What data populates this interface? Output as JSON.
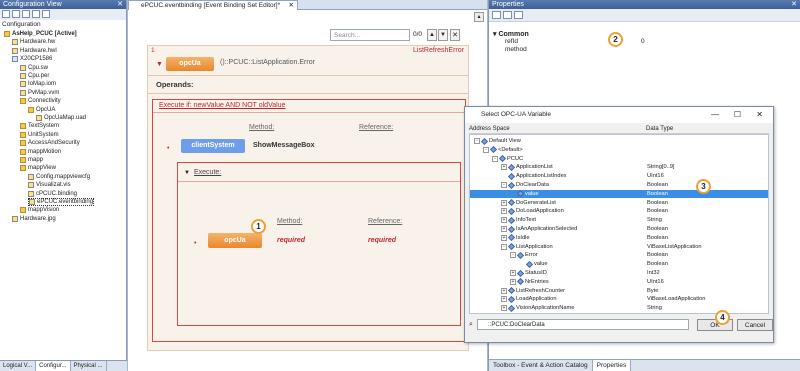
{
  "left_panel": {
    "title": "Configuration View",
    "config_label": "Configuration",
    "tree": [
      {
        "label": "AsHelp_PCUC [Active]",
        "indent": 0,
        "bold": true,
        "icon": "folder"
      },
      {
        "label": "Hardware.hw",
        "indent": 1,
        "icon": "file"
      },
      {
        "label": "Hardware.hwl",
        "indent": 1,
        "icon": "file"
      },
      {
        "label": "X20CP1586",
        "indent": 1,
        "icon": "cpu"
      },
      {
        "label": "Cpu.sw",
        "indent": 2,
        "icon": "file"
      },
      {
        "label": "Cpu.per",
        "indent": 2,
        "icon": "file"
      },
      {
        "label": "IoMap.iom",
        "indent": 2,
        "icon": "file"
      },
      {
        "label": "PvMap.vvm",
        "indent": 2,
        "icon": "file"
      },
      {
        "label": "Connectivity",
        "indent": 2,
        "icon": "folder"
      },
      {
        "label": "OpcUA",
        "indent": 3,
        "icon": "folder"
      },
      {
        "label": "OpcUaMap.uad",
        "indent": 4,
        "icon": "file"
      },
      {
        "label": "TextSystem",
        "indent": 2,
        "icon": "folder"
      },
      {
        "label": "UnitSystem",
        "indent": 2,
        "icon": "folder"
      },
      {
        "label": "AccessAndSecurity",
        "indent": 2,
        "icon": "folder"
      },
      {
        "label": "mappMotion",
        "indent": 2,
        "icon": "folder"
      },
      {
        "label": "mapp",
        "indent": 2,
        "icon": "folder"
      },
      {
        "label": "mappView",
        "indent": 2,
        "icon": "folder"
      },
      {
        "label": "Config.mappviewcfg",
        "indent": 3,
        "icon": "file"
      },
      {
        "label": "Visualizat.vis",
        "indent": 3,
        "icon": "file"
      },
      {
        "label": "cPCUC.binding",
        "indent": 3,
        "icon": "file"
      },
      {
        "label": "ePCUC.eventbinding",
        "indent": 3,
        "icon": "file",
        "selected": true
      },
      {
        "label": "mappVision",
        "indent": 2,
        "icon": "folder"
      },
      {
        "label": "Hardware.jpg",
        "indent": 1,
        "icon": "file"
      }
    ],
    "tabs": [
      "Logical V...",
      "Configur...",
      "Physical ..."
    ]
  },
  "editor": {
    "tab_title": "ePCUC.eventbinding [Event Binding Set Editor]*",
    "search_placeholder": "Search...",
    "search_counter": "0/0",
    "event_index": "1",
    "event_name": "ListRefreshError",
    "source_badge": "opcUa",
    "source_path": "()::PCUC::ListApplication.Error",
    "operands_label": "Operands:",
    "condition": "Execute if: newValue AND NOT oldValue",
    "method_header": "Method:",
    "reference_header": "Reference:",
    "action_badge": "clientSystem",
    "action_method": "ShowMessageBox",
    "execute_label": "Execute:",
    "inner_method_header": "Method:",
    "inner_reference_header": "Reference:",
    "inner_badge": "opcUa",
    "required_1": "required",
    "required_2": "required"
  },
  "properties": {
    "title": "Properties",
    "category": "Common",
    "rows": [
      {
        "name": "refId",
        "value": "0"
      },
      {
        "name": "method",
        "value": ""
      }
    ],
    "bottom_tabs": [
      "Toolbox - Event & Action Catalog",
      "Properties"
    ]
  },
  "dialog": {
    "title": "Select OPC-UA Variable",
    "col_address": "Address Space",
    "col_type": "Data Type",
    "rows": [
      {
        "name": "Default View",
        "type": "",
        "indent": 0,
        "exp": "-"
      },
      {
        "name": "<Default>",
        "type": "",
        "indent": 1,
        "exp": "-"
      },
      {
        "name": "PCUC",
        "type": "",
        "indent": 2,
        "exp": "-"
      },
      {
        "name": "ApplicationList",
        "type": "String[0..9]",
        "indent": 3,
        "exp": "+"
      },
      {
        "name": "ApplicationListIndex",
        "type": "UInt16",
        "indent": 3,
        "exp": ""
      },
      {
        "name": "DoClearData",
        "type": "Boolean",
        "indent": 3,
        "exp": "-"
      },
      {
        "name": "value",
        "type": "Boolean",
        "indent": 4,
        "exp": "",
        "selected": true
      },
      {
        "name": "DoGenerateList",
        "type": "Boolean",
        "indent": 3,
        "exp": "+"
      },
      {
        "name": "DoLoadApplication",
        "type": "Boolean",
        "indent": 3,
        "exp": "+"
      },
      {
        "name": "InfoText",
        "type": "String",
        "indent": 3,
        "exp": "+"
      },
      {
        "name": "IsAnApplicationSelected",
        "type": "Boolean",
        "indent": 3,
        "exp": "+"
      },
      {
        "name": "IsIdle",
        "type": "Boolean",
        "indent": 3,
        "exp": "+"
      },
      {
        "name": "ListApplication",
        "type": "ViBaseListApplication",
        "indent": 3,
        "exp": "-"
      },
      {
        "name": "Error",
        "type": "Boolean",
        "indent": 4,
        "exp": "-"
      },
      {
        "name": "value",
        "type": "Boolean",
        "indent": 5,
        "exp": ""
      },
      {
        "name": "StatusID",
        "type": "Int32",
        "indent": 4,
        "exp": "+"
      },
      {
        "name": "NrEntries",
        "type": "UInt16",
        "indent": 4,
        "exp": "+"
      },
      {
        "name": "ListRefreshCounter",
        "type": "Byte",
        "indent": 3,
        "exp": "+"
      },
      {
        "name": "LoadApplication",
        "type": "ViBaseLoadApplication",
        "indent": 3,
        "exp": "+"
      },
      {
        "name": "VisionApplicationName",
        "type": "String",
        "indent": 3,
        "exp": "+"
      }
    ],
    "filter_value": "::PCUC:DoClearData",
    "ok_label": "OK",
    "cancel_label": "Cancel"
  },
  "callouts": [
    "1",
    "2",
    "3",
    "4"
  ],
  "colors": {
    "accent_orange": "#e8872d",
    "badge_blue": "#6f9ee8",
    "selection": "#3b8ee6",
    "header_blue": "#3e5f96"
  }
}
